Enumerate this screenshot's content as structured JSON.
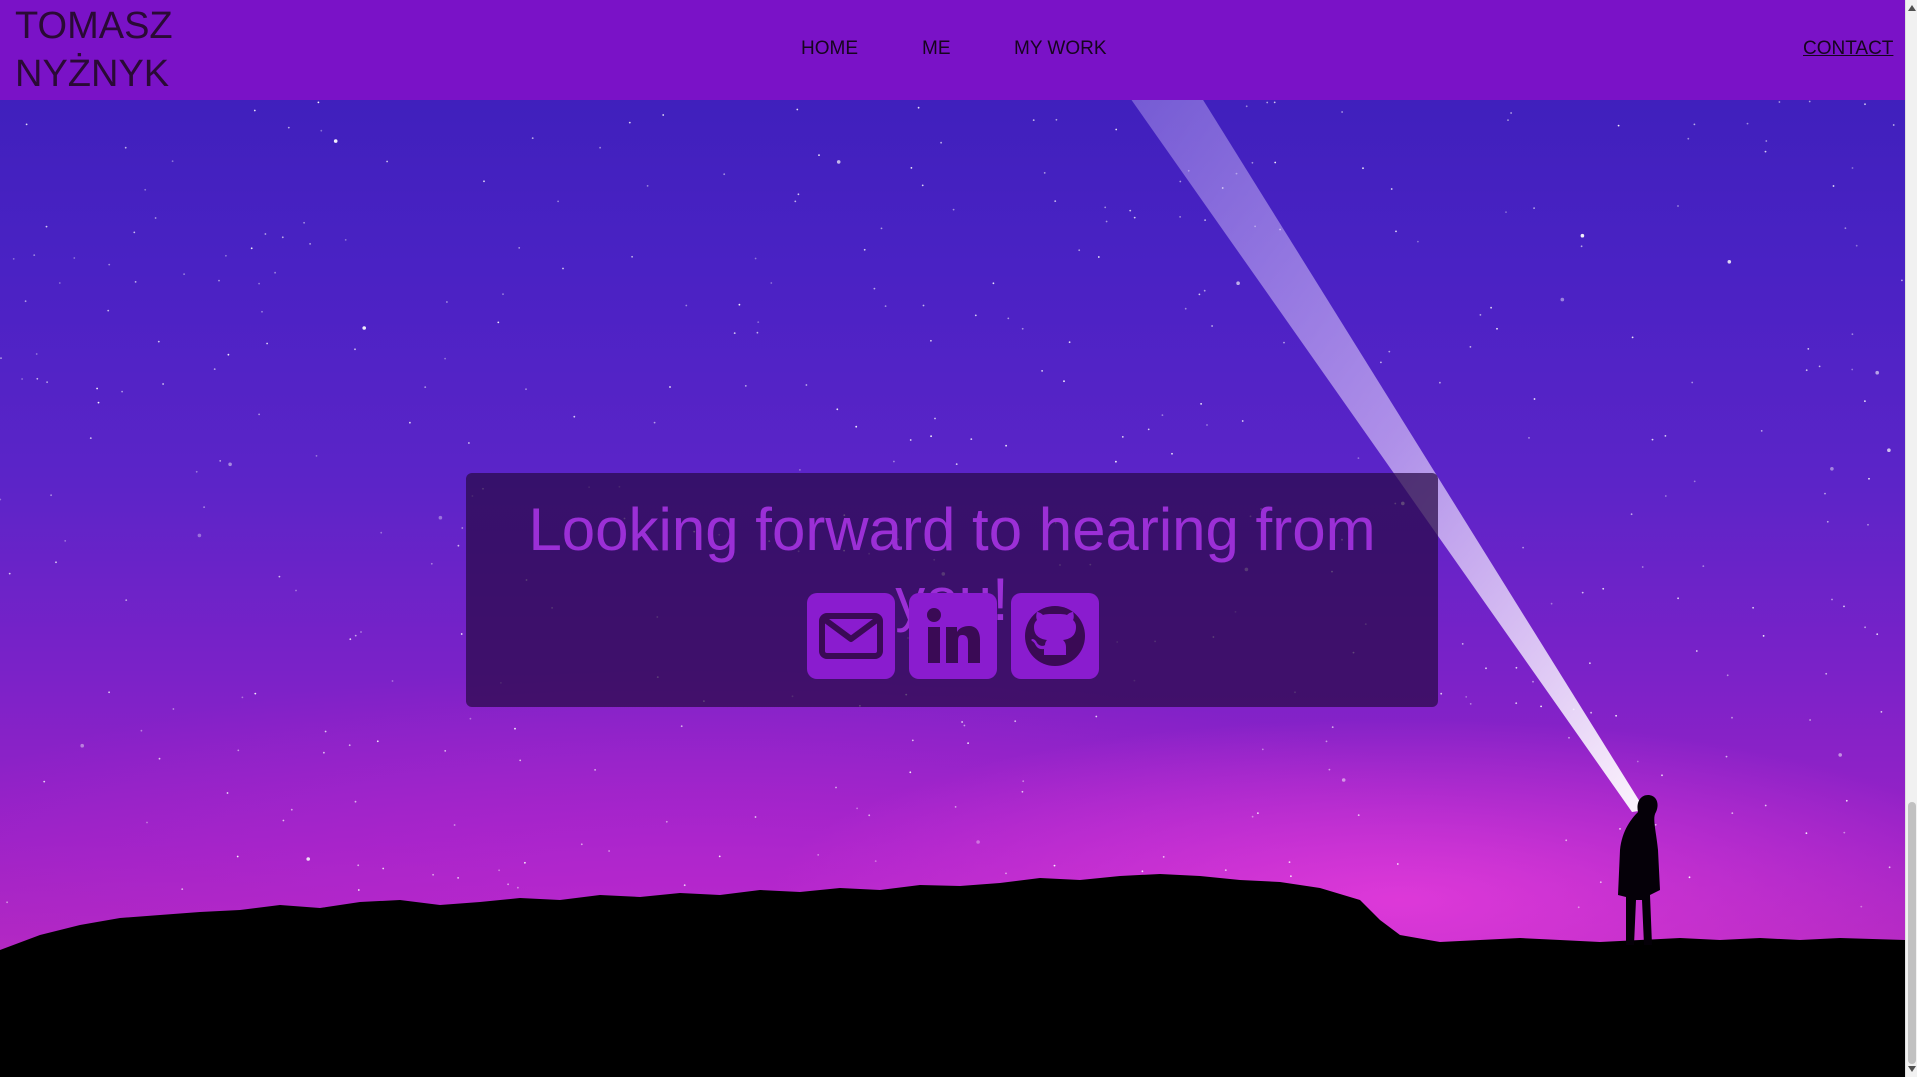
{
  "brand": {
    "line1": "TOMASZ",
    "line2": "NYŻNYK"
  },
  "nav": {
    "items": [
      {
        "label": "HOME"
      },
      {
        "label": "ME"
      },
      {
        "label": "MY WORK"
      },
      {
        "label": "CONTACT",
        "active": true
      }
    ]
  },
  "contact": {
    "heading": "Looking forward to hearing from you!",
    "icons": [
      "envelope-icon",
      "linkedin-icon",
      "github-icon"
    ]
  },
  "colors": {
    "navbar": "#7a12c7",
    "accent": "#9b2fd6",
    "icon_bg": "#8a1ccf"
  }
}
